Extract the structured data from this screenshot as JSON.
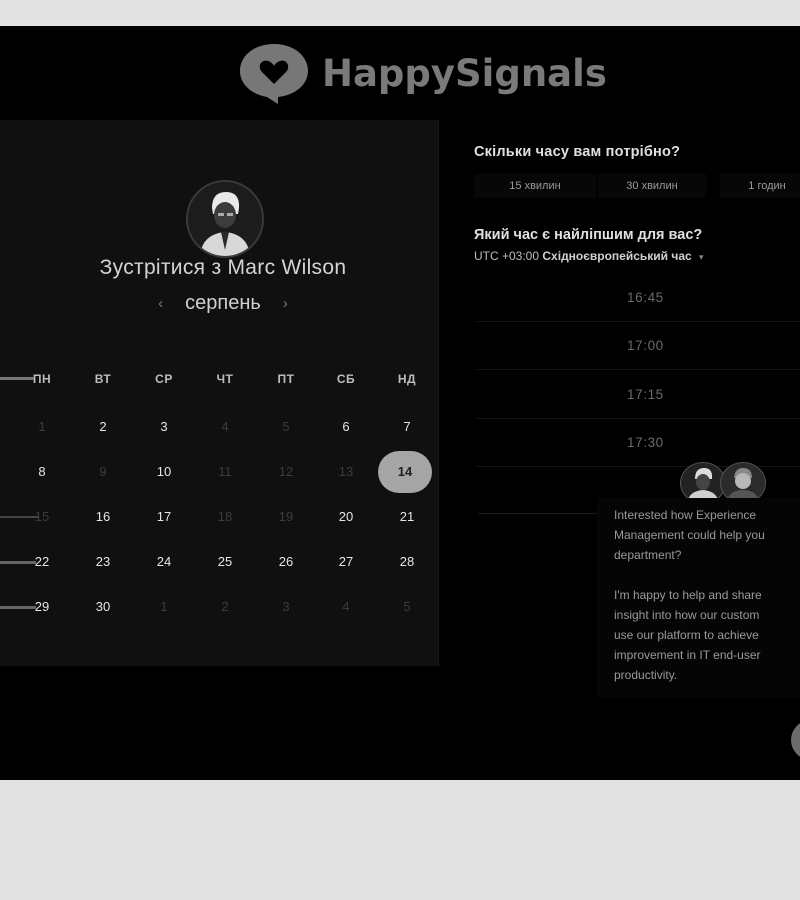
{
  "brand": {
    "name": "HappySignals",
    "logo_icon": "heart-speech-bubble-icon",
    "logo_color": "#7a7a7a"
  },
  "booking": {
    "title": "Зустрітися з Marc Wilson",
    "month": "серпень",
    "prev_icon": "chevron-left-icon",
    "next_icon": "chevron-right-icon",
    "weekdays": [
      "ПН",
      "ВТ",
      "СР",
      "ЧТ",
      "ПТ",
      "СБ",
      "НД"
    ],
    "weeks": [
      [
        "",
        "1",
        "2",
        "3",
        "4",
        "5",
        "6",
        "7"
      ],
      [
        "",
        "8",
        "9",
        "10",
        "11",
        "12",
        "13",
        "14"
      ],
      [
        "",
        "15",
        "16",
        "17",
        "18",
        "19",
        "20",
        "21"
      ],
      [
        "",
        "22",
        "23",
        "24",
        "25",
        "26",
        "27",
        "28"
      ],
      [
        "",
        "29",
        "30",
        "1",
        "2",
        "3",
        "4",
        "5"
      ]
    ],
    "selected_day": "14",
    "selected_color": "#a5a5a5"
  },
  "duration": {
    "question": "Скільки часу вам потрібно?",
    "options": [
      "15 хвилин",
      "30 хвилин",
      "1 годин"
    ]
  },
  "time": {
    "question": "Який час є найліпшим для вас?",
    "timezone_prefix": "UTC +03:00",
    "timezone_name": "Східноєвропейський час",
    "timezone_icon": "caret-down-icon",
    "slots": [
      "16:45",
      "17:00",
      "17:15",
      "17:30"
    ]
  },
  "chat": {
    "message_1": "Interested how Experience\nManagement could help you\ndepartment?",
    "message_2": "I'm happy to help and share\ninsight into how our custom\nuse our platform to achieve\nimprovement in IT end-user\nproductivity."
  }
}
